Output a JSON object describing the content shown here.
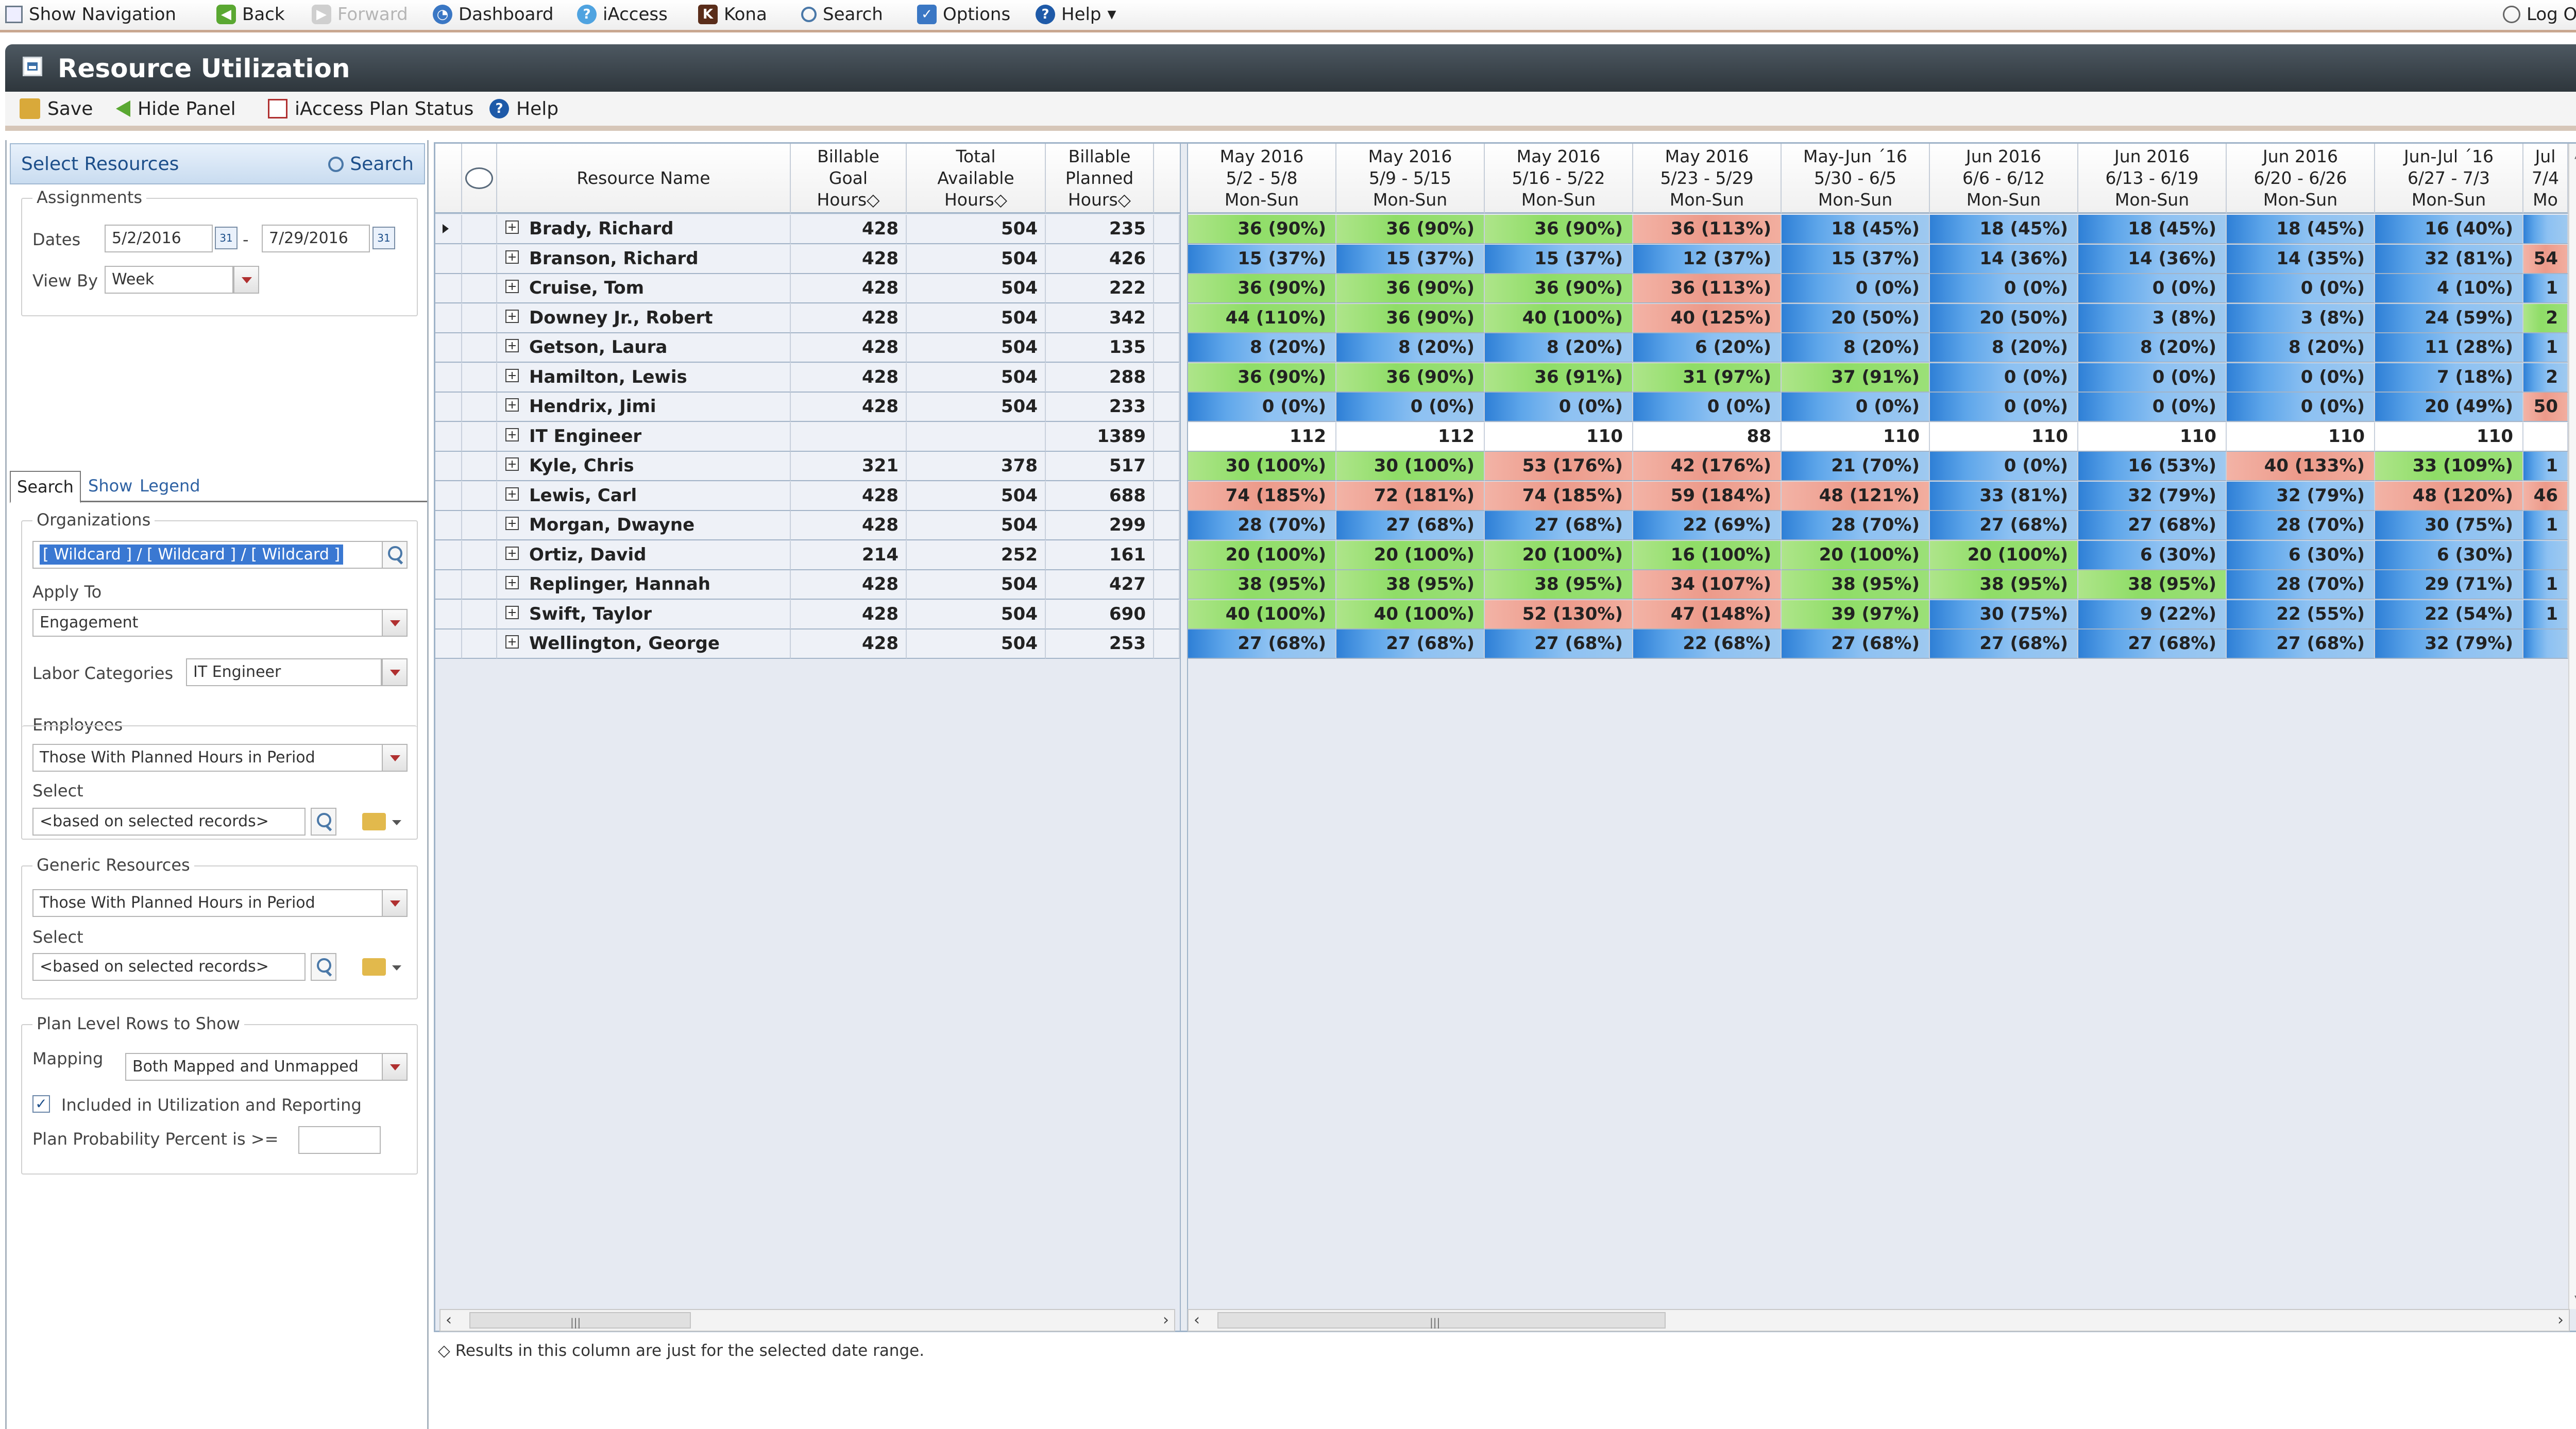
{
  "topnav": {
    "show_navigation": "Show Navigation",
    "back": "Back",
    "forward": "Forward",
    "dashboard": "Dashboard",
    "iaccess": "iAccess",
    "kona": "Kona",
    "search": "Search",
    "options": "Options",
    "help": "Help",
    "logoff": "Log Off"
  },
  "window": {
    "title": "Resource Utilization"
  },
  "toolbar": {
    "save": "Save",
    "hide_panel": "Hide Panel",
    "plan_status": "iAccess Plan Status",
    "help": "Help"
  },
  "left_panel": {
    "header_title": "Select Resources",
    "search_label": "Search",
    "assignments_legend": "Assignments",
    "dates_label": "Dates",
    "date_from": "5/2/2016",
    "date_sep": "-",
    "date_to": "7/29/2016",
    "view_by_label": "View By",
    "view_by_value": "Week",
    "tabs": {
      "search": "Search",
      "show": "Show",
      "legend": "Legend"
    },
    "organizations_legend": "Organizations",
    "organizations_value": "[ Wildcard ] / [ Wildcard ] / [ Wildcard ]",
    "apply_to_label": "Apply To",
    "apply_to_value": "Engagement",
    "labor_categories_label": "Labor Categories",
    "labor_categories_value": "IT Engineer",
    "employees_legend": "Employees",
    "employees_value": "Those With Planned Hours in Period",
    "employees_select_label": "Select",
    "employees_select_value": "<based on selected records>",
    "generic_legend": "Generic Resources",
    "generic_value": "Those With Planned Hours in Period",
    "generic_select_label": "Select",
    "generic_select_value": "<based on selected records>",
    "plan_rows_legend": "Plan Level Rows to Show",
    "mapping_label": "Mapping",
    "mapping_value": "Both Mapped and Unmapped",
    "included_label": "Included in Utilization and Reporting",
    "included_checked": true,
    "probability_label": "Plan Probability Percent is >=",
    "probability_value": ""
  },
  "grid": {
    "headers": {
      "resource_name": "Resource Name",
      "goal": [
        "Billable",
        "Goal",
        "Hours◇"
      ],
      "available": [
        "Total",
        "Available",
        "Hours◇"
      ],
      "planned": [
        "Billable",
        "Planned",
        "Hours◇"
      ]
    },
    "weeks": [
      {
        "l1": "May 2016",
        "l2": "5/2 - 5/8",
        "l3": "Mon-Sun"
      },
      {
        "l1": "May 2016",
        "l2": "5/9 - 5/15",
        "l3": "Mon-Sun"
      },
      {
        "l1": "May 2016",
        "l2": "5/16 - 5/22",
        "l3": "Mon-Sun"
      },
      {
        "l1": "May 2016",
        "l2": "5/23 - 5/29",
        "l3": "Mon-Sun"
      },
      {
        "l1": "May-Jun ´16",
        "l2": "5/30 - 6/5",
        "l3": "Mon-Sun"
      },
      {
        "l1": "Jun 2016",
        "l2": "6/6 - 6/12",
        "l3": "Mon-Sun"
      },
      {
        "l1": "Jun 2016",
        "l2": "6/13 - 6/19",
        "l3": "Mon-Sun"
      },
      {
        "l1": "Jun 2016",
        "l2": "6/20 - 6/26",
        "l3": "Mon-Sun"
      },
      {
        "l1": "Jun-Jul ´16",
        "l2": "6/27 - 7/3",
        "l3": "Mon-Sun"
      },
      {
        "l1": "Jul",
        "l2": "7/4",
        "l3": "Mo"
      }
    ],
    "rows": [
      {
        "name": "Brady, Richard",
        "goal": "428",
        "avail": "504",
        "planned": "235",
        "selected": true,
        "weeks": [
          [
            "36 (90%)",
            "green"
          ],
          [
            "36 (90%)",
            "green"
          ],
          [
            "36 (90%)",
            "green"
          ],
          [
            "36 (113%)",
            "red"
          ],
          [
            "18 (45%)",
            "blue"
          ],
          [
            "18 (45%)",
            "blue"
          ],
          [
            "18 (45%)",
            "blue"
          ],
          [
            "18 (45%)",
            "blue"
          ],
          [
            "16 (40%)",
            "blue"
          ],
          [
            "",
            "blue"
          ]
        ]
      },
      {
        "name": "Branson, Richard",
        "goal": "428",
        "avail": "504",
        "planned": "426",
        "weeks": [
          [
            "15 (37%)",
            "blue"
          ],
          [
            "15 (37%)",
            "blue"
          ],
          [
            "15 (37%)",
            "blue"
          ],
          [
            "12 (37%)",
            "blue"
          ],
          [
            "15 (37%)",
            "blue"
          ],
          [
            "14 (36%)",
            "blue"
          ],
          [
            "14 (36%)",
            "blue"
          ],
          [
            "14 (35%)",
            "blue"
          ],
          [
            "32 (81%)",
            "blue"
          ],
          [
            "54",
            "red"
          ]
        ]
      },
      {
        "name": "Cruise, Tom",
        "goal": "428",
        "avail": "504",
        "planned": "222",
        "weeks": [
          [
            "36 (90%)",
            "green"
          ],
          [
            "36 (90%)",
            "green"
          ],
          [
            "36 (90%)",
            "green"
          ],
          [
            "36 (113%)",
            "red"
          ],
          [
            "0 (0%)",
            "blue"
          ],
          [
            "0 (0%)",
            "blue"
          ],
          [
            "0 (0%)",
            "blue"
          ],
          [
            "0 (0%)",
            "blue"
          ],
          [
            "4 (10%)",
            "blue"
          ],
          [
            "1",
            "blue"
          ]
        ]
      },
      {
        "name": "Downey Jr., Robert",
        "goal": "428",
        "avail": "504",
        "planned": "342",
        "weeks": [
          [
            "44 (110%)",
            "green"
          ],
          [
            "36 (90%)",
            "green"
          ],
          [
            "40 (100%)",
            "green"
          ],
          [
            "40 (125%)",
            "red"
          ],
          [
            "20 (50%)",
            "blue"
          ],
          [
            "20 (50%)",
            "blue"
          ],
          [
            "3 (8%)",
            "blue"
          ],
          [
            "3 (8%)",
            "blue"
          ],
          [
            "24 (59%)",
            "blue"
          ],
          [
            "2",
            "green"
          ]
        ]
      },
      {
        "name": "Getson, Laura",
        "goal": "428",
        "avail": "504",
        "planned": "135",
        "weeks": [
          [
            "8 (20%)",
            "blue"
          ],
          [
            "8 (20%)",
            "blue"
          ],
          [
            "8 (20%)",
            "blue"
          ],
          [
            "6 (20%)",
            "blue"
          ],
          [
            "8 (20%)",
            "blue"
          ],
          [
            "8 (20%)",
            "blue"
          ],
          [
            "8 (20%)",
            "blue"
          ],
          [
            "8 (20%)",
            "blue"
          ],
          [
            "11 (28%)",
            "blue"
          ],
          [
            "1",
            "blue"
          ]
        ]
      },
      {
        "name": "Hamilton, Lewis",
        "goal": "428",
        "avail": "504",
        "planned": "288",
        "weeks": [
          [
            "36 (90%)",
            "green"
          ],
          [
            "36 (90%)",
            "green"
          ],
          [
            "36 (91%)",
            "green"
          ],
          [
            "31 (97%)",
            "green"
          ],
          [
            "37 (91%)",
            "green"
          ],
          [
            "0 (0%)",
            "blue"
          ],
          [
            "0 (0%)",
            "blue"
          ],
          [
            "0 (0%)",
            "blue"
          ],
          [
            "7 (18%)",
            "blue"
          ],
          [
            "2",
            "blue"
          ]
        ]
      },
      {
        "name": "Hendrix, Jimi",
        "goal": "428",
        "avail": "504",
        "planned": "233",
        "weeks": [
          [
            "0 (0%)",
            "blue"
          ],
          [
            "0 (0%)",
            "blue"
          ],
          [
            "0 (0%)",
            "blue"
          ],
          [
            "0 (0%)",
            "blue"
          ],
          [
            "0 (0%)",
            "blue"
          ],
          [
            "0 (0%)",
            "blue"
          ],
          [
            "0 (0%)",
            "blue"
          ],
          [
            "0 (0%)",
            "blue"
          ],
          [
            "20 (49%)",
            "blue"
          ],
          [
            "50",
            "red"
          ]
        ]
      },
      {
        "name": "IT Engineer",
        "goal": "",
        "avail": "",
        "planned": "1389",
        "weeks": [
          [
            "112",
            "plain"
          ],
          [
            "112",
            "plain"
          ],
          [
            "110",
            "plain"
          ],
          [
            "88",
            "plain"
          ],
          [
            "110",
            "plain"
          ],
          [
            "110",
            "plain"
          ],
          [
            "110",
            "plain"
          ],
          [
            "110",
            "plain"
          ],
          [
            "110",
            "plain"
          ],
          [
            "",
            "plain"
          ]
        ]
      },
      {
        "name": "Kyle, Chris",
        "goal": "321",
        "avail": "378",
        "planned": "517",
        "weeks": [
          [
            "30 (100%)",
            "green"
          ],
          [
            "30 (100%)",
            "green"
          ],
          [
            "53 (176%)",
            "red"
          ],
          [
            "42 (176%)",
            "red"
          ],
          [
            "21 (70%)",
            "blue"
          ],
          [
            "0 (0%)",
            "blue"
          ],
          [
            "16 (53%)",
            "blue"
          ],
          [
            "40 (133%)",
            "red"
          ],
          [
            "33 (109%)",
            "green"
          ],
          [
            "1",
            "blue"
          ]
        ]
      },
      {
        "name": "Lewis, Carl",
        "goal": "428",
        "avail": "504",
        "planned": "688",
        "weeks": [
          [
            "74 (185%)",
            "red"
          ],
          [
            "72 (181%)",
            "red"
          ],
          [
            "74 (185%)",
            "red"
          ],
          [
            "59 (184%)",
            "red"
          ],
          [
            "48 (121%)",
            "red"
          ],
          [
            "33 (81%)",
            "blue"
          ],
          [
            "32 (79%)",
            "blue"
          ],
          [
            "32 (79%)",
            "blue"
          ],
          [
            "48 (120%)",
            "red"
          ],
          [
            "46",
            "red"
          ]
        ]
      },
      {
        "name": "Morgan, Dwayne",
        "goal": "428",
        "avail": "504",
        "planned": "299",
        "weeks": [
          [
            "28 (70%)",
            "blue"
          ],
          [
            "27 (68%)",
            "blue"
          ],
          [
            "27 (68%)",
            "blue"
          ],
          [
            "22 (69%)",
            "blue"
          ],
          [
            "28 (70%)",
            "blue"
          ],
          [
            "27 (68%)",
            "blue"
          ],
          [
            "27 (68%)",
            "blue"
          ],
          [
            "28 (70%)",
            "blue"
          ],
          [
            "30 (75%)",
            "blue"
          ],
          [
            "1",
            "blue"
          ]
        ]
      },
      {
        "name": "Ortiz, David",
        "goal": "214",
        "avail": "252",
        "planned": "161",
        "weeks": [
          [
            "20 (100%)",
            "green"
          ],
          [
            "20 (100%)",
            "green"
          ],
          [
            "20 (100%)",
            "green"
          ],
          [
            "16 (100%)",
            "green"
          ],
          [
            "20 (100%)",
            "green"
          ],
          [
            "20 (100%)",
            "green"
          ],
          [
            "6 (30%)",
            "blue"
          ],
          [
            "6 (30%)",
            "blue"
          ],
          [
            "6 (30%)",
            "blue"
          ],
          [
            "",
            "blue"
          ]
        ]
      },
      {
        "name": "Replinger, Hannah",
        "goal": "428",
        "avail": "504",
        "planned": "427",
        "weeks": [
          [
            "38 (95%)",
            "green"
          ],
          [
            "38 (95%)",
            "green"
          ],
          [
            "38 (95%)",
            "green"
          ],
          [
            "34 (107%)",
            "red"
          ],
          [
            "38 (95%)",
            "green"
          ],
          [
            "38 (95%)",
            "green"
          ],
          [
            "38 (95%)",
            "green"
          ],
          [
            "28 (70%)",
            "blue"
          ],
          [
            "29 (71%)",
            "blue"
          ],
          [
            "1",
            "blue"
          ]
        ]
      },
      {
        "name": "Swift, Taylor",
        "goal": "428",
        "avail": "504",
        "planned": "690",
        "weeks": [
          [
            "40 (100%)",
            "green"
          ],
          [
            "40 (100%)",
            "green"
          ],
          [
            "52 (130%)",
            "red"
          ],
          [
            "47 (148%)",
            "red"
          ],
          [
            "39 (97%)",
            "green"
          ],
          [
            "30 (75%)",
            "blue"
          ],
          [
            "9 (22%)",
            "blue"
          ],
          [
            "22 (55%)",
            "blue"
          ],
          [
            "22 (54%)",
            "blue"
          ],
          [
            "1",
            "blue"
          ]
        ]
      },
      {
        "name": "Wellington, George",
        "goal": "428",
        "avail": "504",
        "planned": "253",
        "weeks": [
          [
            "27 (68%)",
            "blue"
          ],
          [
            "27 (68%)",
            "blue"
          ],
          [
            "27 (68%)",
            "blue"
          ],
          [
            "22 (68%)",
            "blue"
          ],
          [
            "27 (68%)",
            "blue"
          ],
          [
            "27 (68%)",
            "blue"
          ],
          [
            "27 (68%)",
            "blue"
          ],
          [
            "27 (68%)",
            "blue"
          ],
          [
            "32 (79%)",
            "blue"
          ],
          [
            "",
            "blue"
          ]
        ]
      }
    ]
  },
  "footnote": "◇ Results in this column are just for the selected date range."
}
